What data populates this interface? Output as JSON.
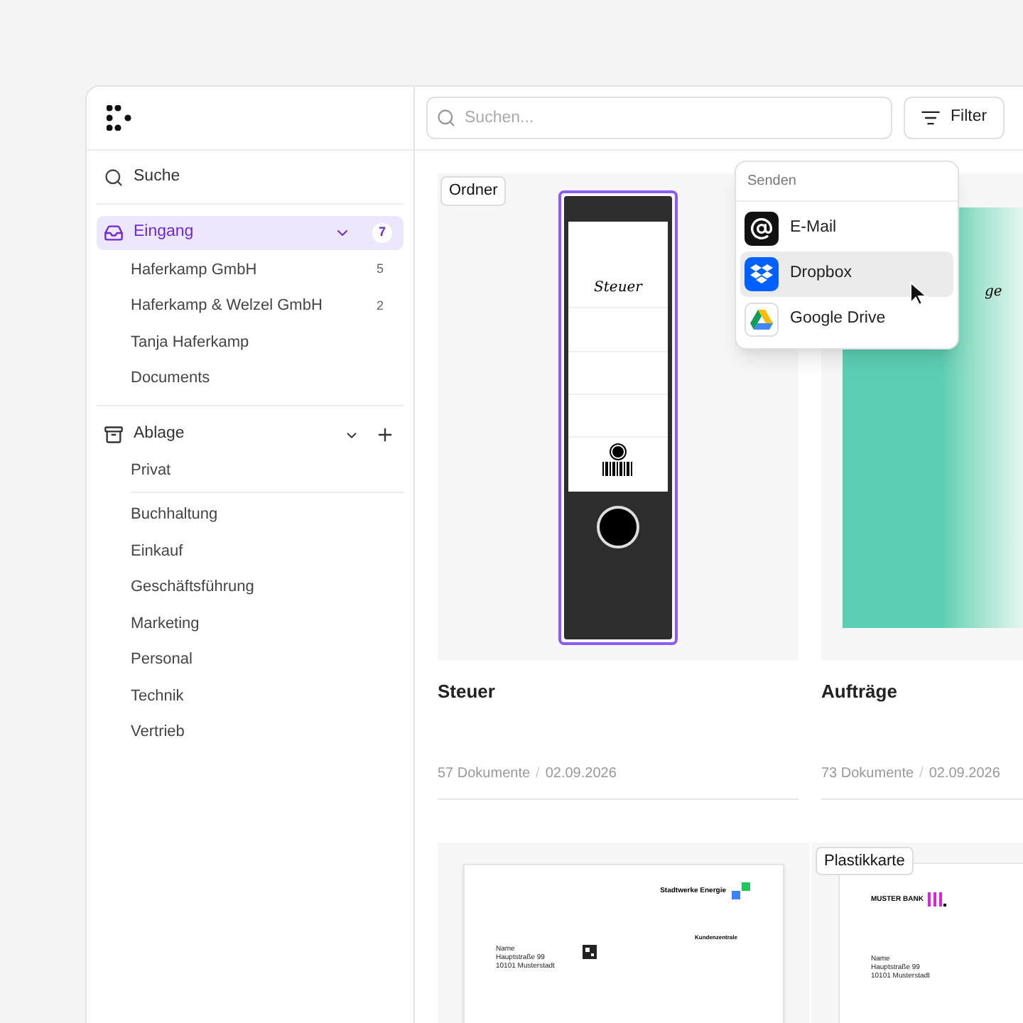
{
  "sidebar": {
    "search": "Suche",
    "inbox": {
      "label": "Eingang",
      "selected": true,
      "expanded": true,
      "count": "7",
      "children": [
        {
          "label": "Haferkamp GmbH",
          "count": "5"
        },
        {
          "label": "Haferkamp & Welzel GmbH",
          "count": "2"
        },
        {
          "label": "Tanja Haferkamp"
        },
        {
          "label": "Documents"
        }
      ]
    },
    "archive": {
      "label": "Ablage",
      "expanded": true,
      "groups": [
        [
          "Privat"
        ],
        [
          "Buchhaltung",
          "Einkauf",
          "Geschäftsführung",
          "Marketing",
          "Personal",
          "Technik",
          "Vertrieb"
        ]
      ]
    }
  },
  "toolbar": {
    "search": {
      "placeholder": "Suchen..."
    },
    "filter": "Filter"
  },
  "send_menu": {
    "title": "Senden",
    "items": [
      {
        "kind": "email",
        "label": "E-Mail",
        "selected": false
      },
      {
        "kind": "dropbox",
        "label": "Dropbox",
        "selected": true
      },
      {
        "kind": "gdrive",
        "label": "Google Drive",
        "selected": false
      }
    ]
  },
  "cards": [
    {
      "kind": "binder",
      "badge": "Ordner",
      "selected": true,
      "spine_label": "Steuer",
      "title": "Steuer",
      "count": "57 Dokumente",
      "separator": "/",
      "date": "02.09.2026"
    },
    {
      "kind": "folder",
      "label_text": "ge",
      "title": "Aufträge",
      "count": "73 Dokumente",
      "separator": "/",
      "date": "02.09.2026"
    },
    {
      "kind": "letter",
      "sender": "Stadtwerke Energie",
      "address": [
        "Name",
        "Hauptstraße 99",
        "10101 Musterstadt"
      ],
      "side_heading": "Kundenzentrale"
    },
    {
      "kind": "plastic_card",
      "badge": "Plastikkarte",
      "sender": "MUSTER BANK",
      "address": [
        "Name",
        "Hauptstraße 99",
        "10101 Musterstadt"
      ]
    }
  ]
}
